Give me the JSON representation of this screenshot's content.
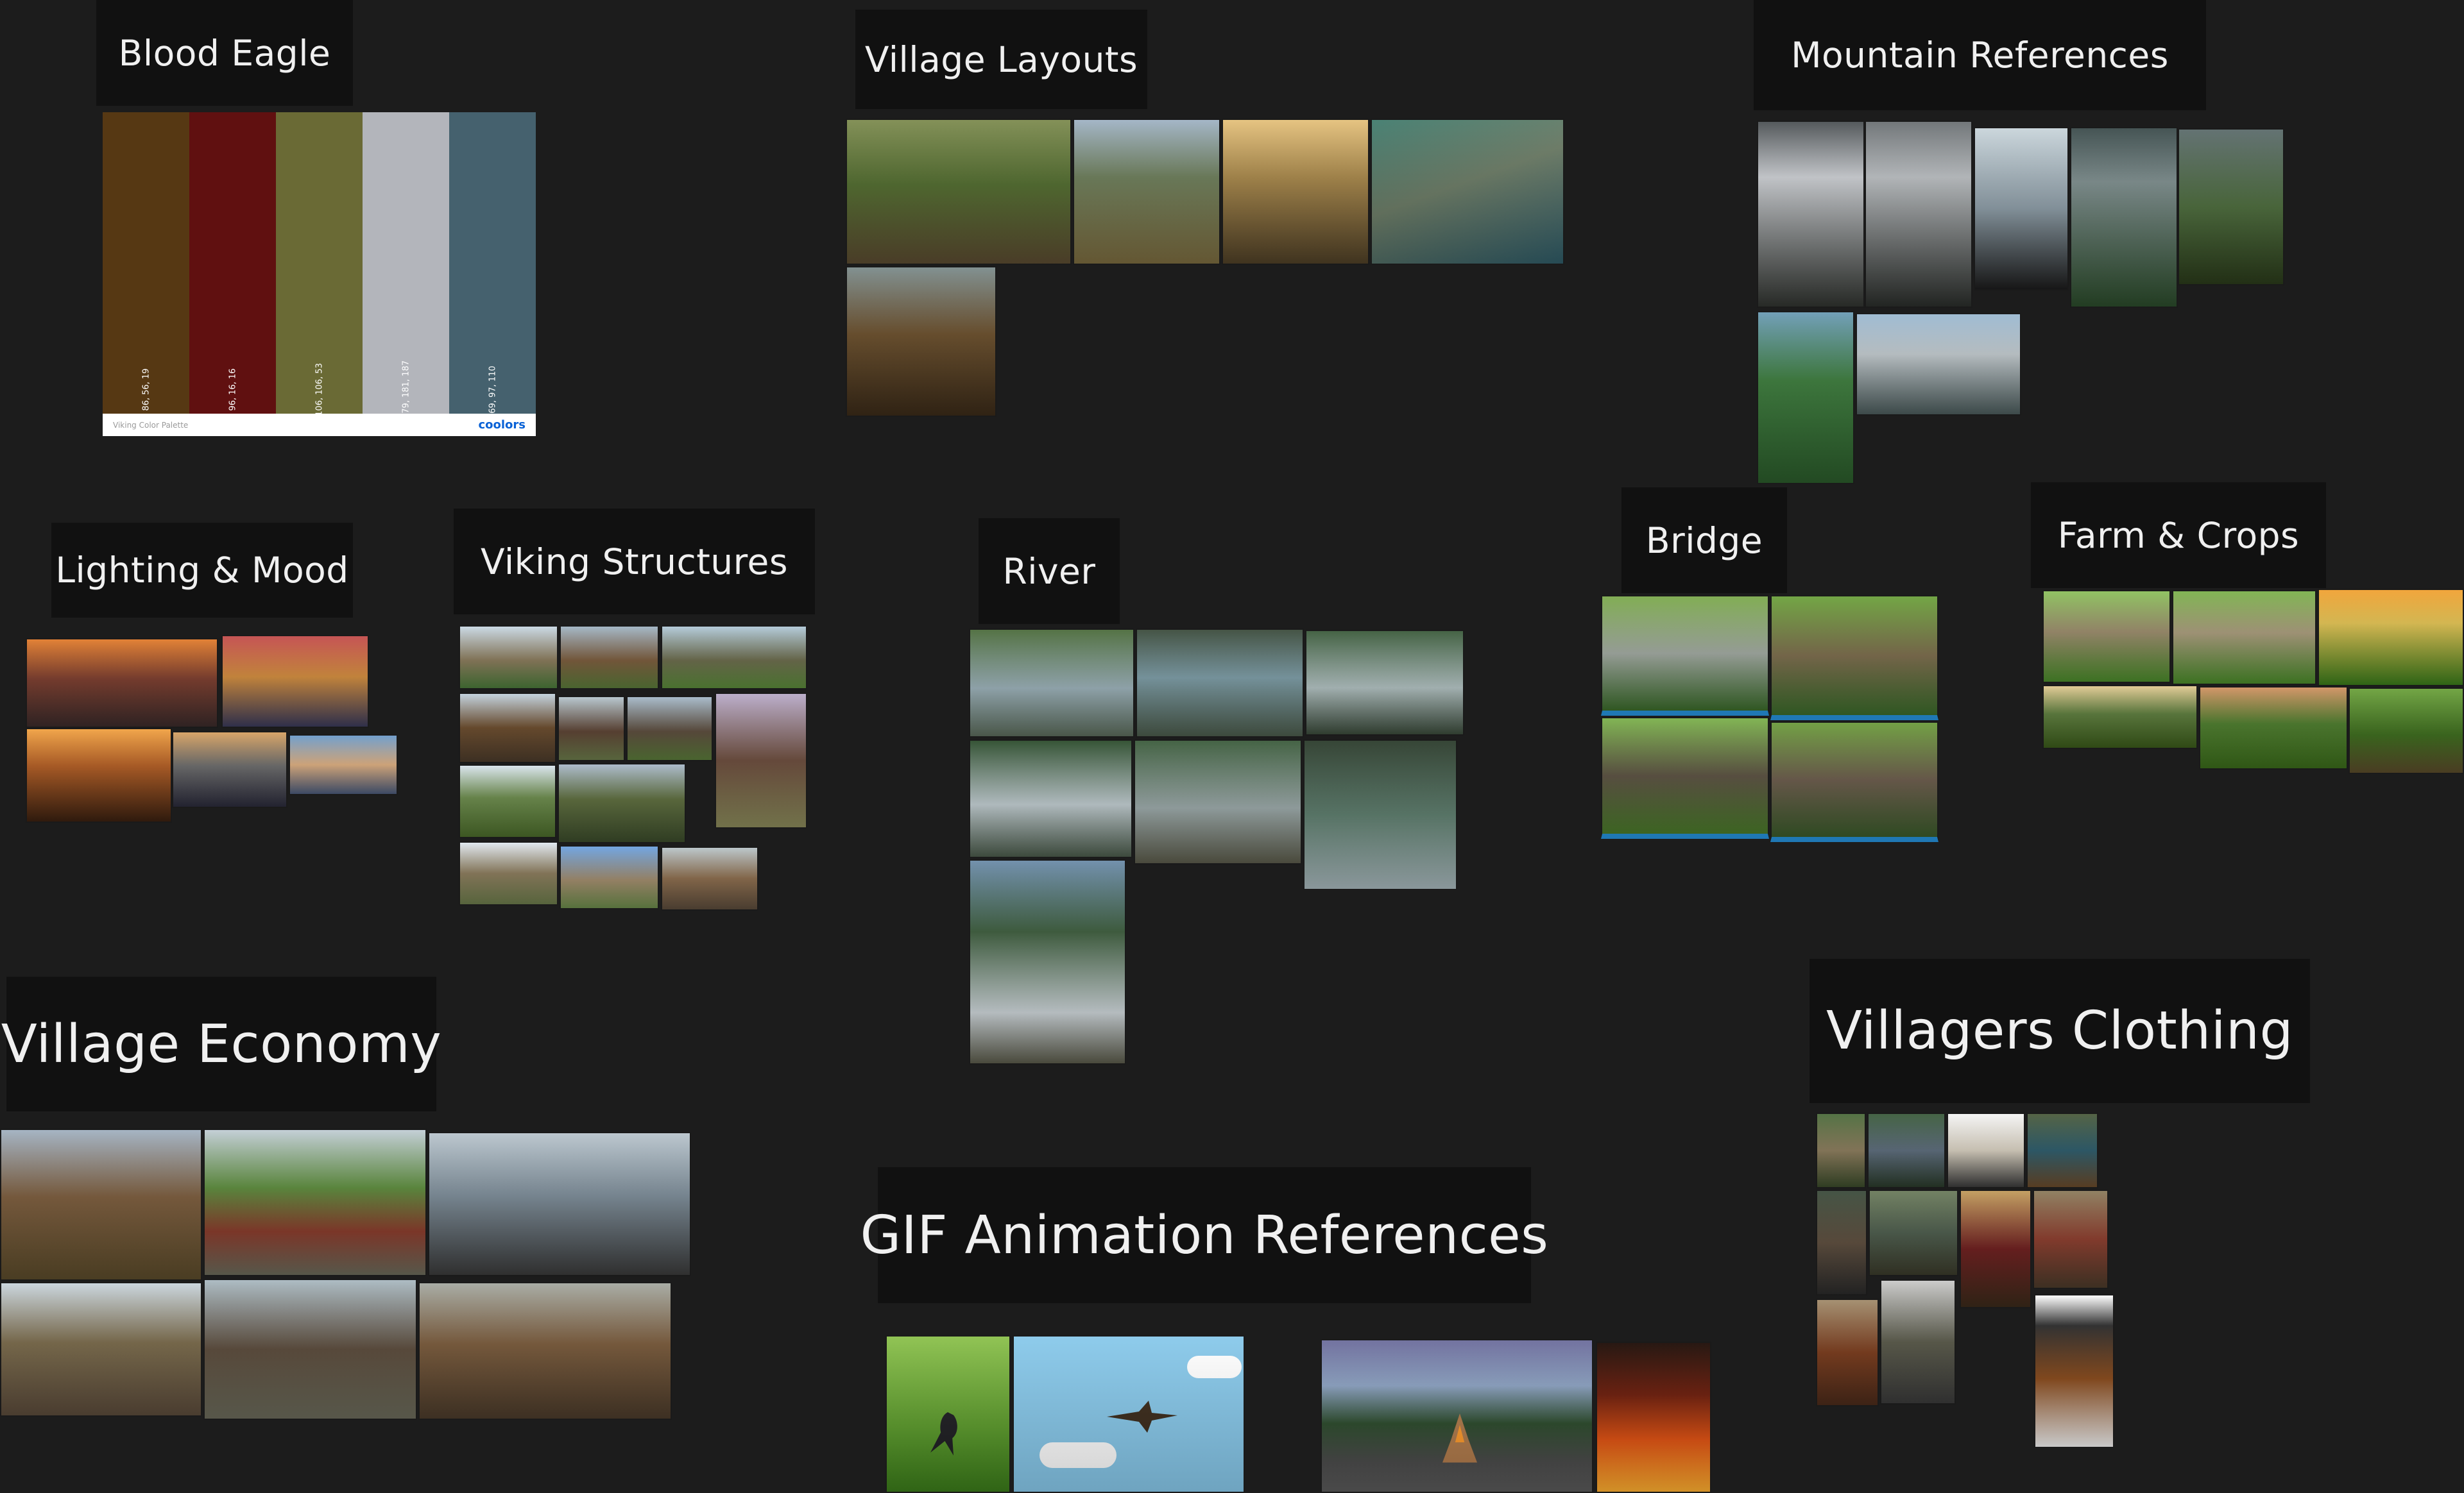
{
  "labels": {
    "blood_eagle": "Blood Eagle",
    "village_layouts": "Village Layouts",
    "mountain_references": "Mountain References",
    "lighting_mood": "Lighting & Mood",
    "viking_structures": "Viking Structures",
    "river": "River",
    "bridge": "Bridge",
    "farm_crops": "Farm & Crops",
    "village_economy": "Village Economy",
    "villagers_clothing": "Villagers Clothing",
    "gif_animation": "GIF Animation References"
  },
  "palette": {
    "name": "Viking Color Palette",
    "brand": "coolors",
    "swatches": [
      {
        "rgb": "86, 56, 19",
        "color": "#563813"
      },
      {
        "rgb": "96, 16, 16",
        "color": "#601010"
      },
      {
        "rgb": "106, 106, 53",
        "color": "#6a6a35"
      },
      {
        "rgb": "179, 181, 187",
        "color": "#b3b5bb"
      },
      {
        "rgb": "69, 97, 110",
        "color": "#45616e"
      }
    ]
  },
  "colors": {
    "board_background": "#1c1c1c",
    "label_background": "#111111",
    "label_text": "#f0f0f0"
  }
}
